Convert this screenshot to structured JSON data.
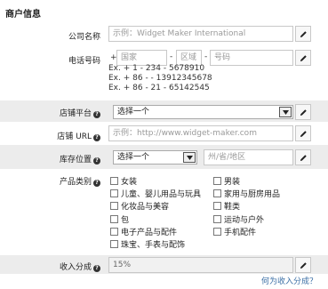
{
  "section_title": "商户信息",
  "company": {
    "label": "公司名称",
    "placeholder": "示例：Widget Maker International"
  },
  "phone": {
    "label": "电话号码",
    "plus": "+",
    "country_placeholder": "国家",
    "area_placeholder": "区域",
    "number_placeholder": "号码",
    "separator": "-",
    "examples": [
      "Ex. + 1 - 234 - 5678910",
      "Ex. + 86 - - 13912345678",
      "Ex. + 86 - 21 - 65142545"
    ]
  },
  "platform": {
    "label": "店铺平台",
    "selected": "选择一个"
  },
  "store_url": {
    "label": "店铺 URL",
    "placeholder": "示例：http://www.widget-maker.com"
  },
  "inventory": {
    "label": "库存位置",
    "selected": "选择一个",
    "state_placeholder": "州/省/地区"
  },
  "category": {
    "label": "产品类别",
    "left": [
      "女装",
      "儿童、婴儿用品与玩具",
      "化妆品与美容",
      "包",
      "电子产品与配件",
      "珠宝、手表与配饰"
    ],
    "right": [
      "男装",
      "家用与厨房用品",
      "鞋类",
      "运动与户外",
      "手机配件"
    ]
  },
  "revenue_share": {
    "label": "收入分成",
    "value": "15%",
    "help_link": "何为收入分成？"
  },
  "icons": {
    "help": "help-icon",
    "edit": "pencil-icon",
    "dropdown": "dropdown-arrow-icon"
  }
}
